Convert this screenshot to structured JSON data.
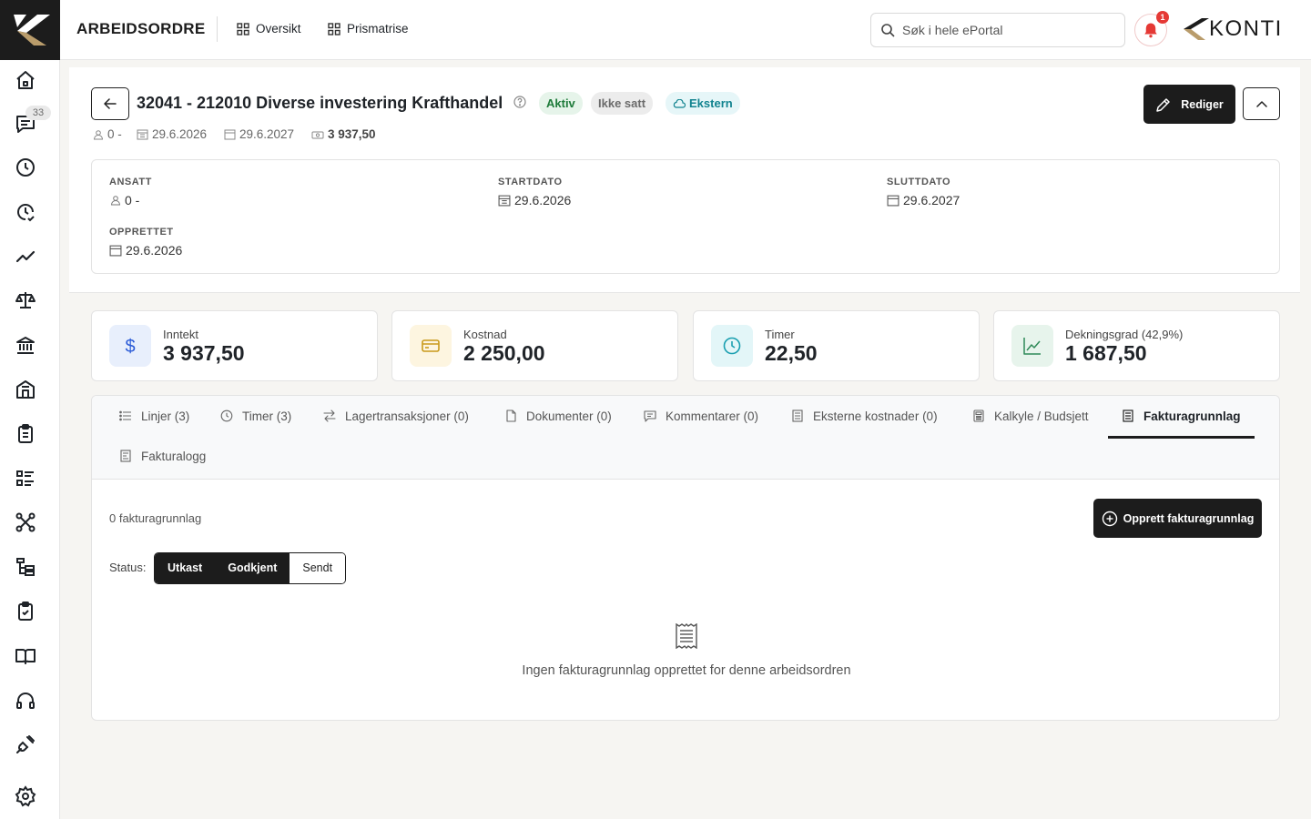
{
  "header": {
    "app_title": "ARBEIDSORDRE",
    "nav": [
      {
        "label": "Oversikt",
        "icon": "grid-icon"
      },
      {
        "label": "Prismatrise",
        "icon": "grid-icon"
      }
    ],
    "search_placeholder": "Søk i hele ePortal",
    "notification_count": "1",
    "brand": "KONTI"
  },
  "sidebar": {
    "items": [
      {
        "icon": "home-icon"
      },
      {
        "icon": "chat-icon",
        "badge": "33"
      },
      {
        "icon": "clock-icon"
      },
      {
        "icon": "clock-check-icon"
      },
      {
        "icon": "trend-icon"
      },
      {
        "icon": "scale-icon"
      },
      {
        "icon": "bank-icon"
      },
      {
        "icon": "building-icon"
      },
      {
        "icon": "clipboard-icon"
      },
      {
        "icon": "list-icon"
      },
      {
        "icon": "network-icon"
      },
      {
        "icon": "tree-icon"
      },
      {
        "icon": "clipboard-check-icon"
      },
      {
        "icon": "book-icon"
      },
      {
        "icon": "headset-icon"
      },
      {
        "icon": "plug-icon"
      },
      {
        "icon": "settings-icon"
      }
    ]
  },
  "order": {
    "title": "32041 - 212010 Diverse investering Krafthandel",
    "badges": {
      "status": "Aktiv",
      "state": "Ikke satt",
      "type": "Ekstern"
    },
    "meta": {
      "employee": "0 -",
      "start": "29.6.2026",
      "end": "29.6.2027",
      "amount": "3 937,50"
    },
    "edit_label": "Rediger",
    "details": {
      "ansatt_label": "ANSATT",
      "ansatt_value": "0 -",
      "startdato_label": "STARTDATO",
      "startdato_value": "29.6.2026",
      "sluttdato_label": "SLUTTDATO",
      "sluttdato_value": "29.6.2027",
      "opprettet_label": "OPPRETTET",
      "opprettet_value": "29.6.2026"
    }
  },
  "stats": [
    {
      "label": "Inntekt",
      "value": "3 937,50",
      "icon": "dollar-icon",
      "color": "#2b5bd7",
      "bg": "#e8effc"
    },
    {
      "label": "Kostnad",
      "value": "2 250,00",
      "icon": "card-icon",
      "color": "#c99a1a",
      "bg": "#fdf5e0"
    },
    {
      "label": "Timer",
      "value": "22,50",
      "icon": "clock-icon",
      "color": "#1a9fb0",
      "bg": "#e3f6f8"
    },
    {
      "label": "Dekningsgrad (42,9%)",
      "value": "1 687,50",
      "icon": "chart-line-icon",
      "color": "#2f8a58",
      "bg": "#e7f4ec"
    }
  ],
  "tabs": [
    {
      "label": "Linjer (3)",
      "icon": "list-icon"
    },
    {
      "label": "Timer (3)",
      "icon": "clock-icon"
    },
    {
      "label": "Lagertransaksjoner (0)",
      "icon": "swap-icon"
    },
    {
      "label": "Dokumenter (0)",
      "icon": "file-icon"
    },
    {
      "label": "Kommentarer (0)",
      "icon": "comment-icon"
    },
    {
      "label": "Eksterne kostnader (0)",
      "icon": "receipt-icon"
    },
    {
      "label": "Kalkyle / Budsjett",
      "icon": "calculator-icon"
    },
    {
      "label": "Fakturagrunnlag",
      "icon": "receipt-icon",
      "active": true
    },
    {
      "label": "Fakturalogg",
      "icon": "receipt-icon"
    }
  ],
  "invoice": {
    "count_text": "0 fakturagrunnlag",
    "create_label": "Opprett fakturagrunnlag",
    "status_label": "Status:",
    "status_options": [
      "Utkast",
      "Godkjent",
      "Sendt"
    ],
    "empty_text": "Ingen fakturagrunnlag opprettet for denne arbeidsordren"
  }
}
